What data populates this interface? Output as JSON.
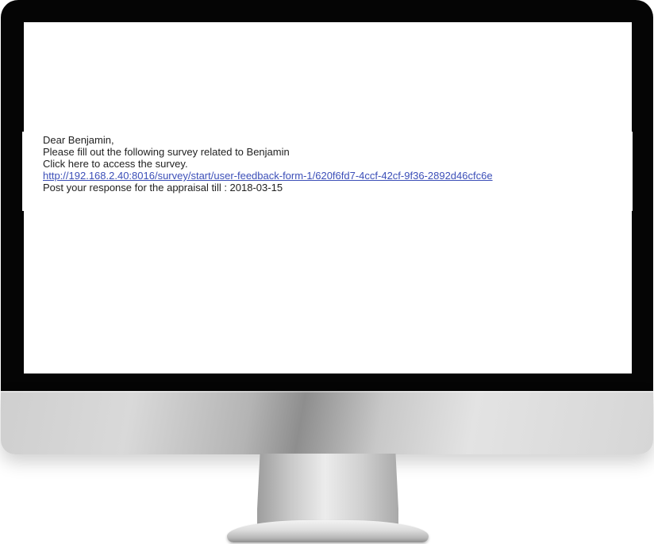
{
  "email": {
    "greeting": "Dear Benjamin,",
    "line1": "Please fill out the following survey related to Benjamin",
    "line2": "Click here to access the survey.",
    "survey_link": "http://192.168.2.40:8016/survey/start/user-feedback-form-1/620f6fd7-4ccf-42cf-9f36-2892d46cfc6e",
    "deadline": "Post your response for the appraisal till : 2018-03-15"
  },
  "colors": {
    "bezel": "#050505",
    "screen": "#ffffff",
    "link": "#3c4fb8",
    "text": "#222222"
  }
}
